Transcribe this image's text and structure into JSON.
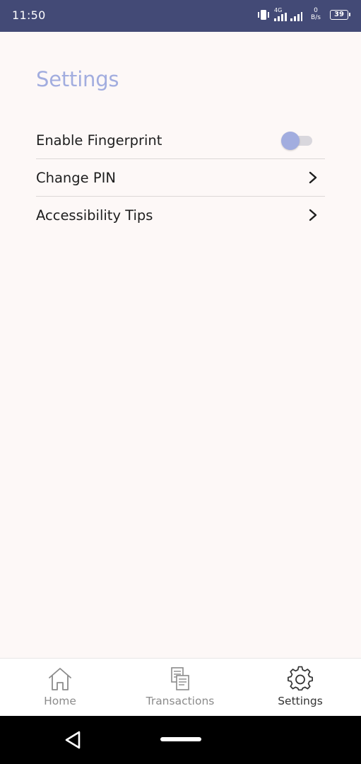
{
  "status_bar": {
    "time": "11:50",
    "network_type": "4G",
    "speed_value": "0",
    "speed_unit": "B/s",
    "battery": "39"
  },
  "page": {
    "title": "Settings"
  },
  "settings": {
    "items": [
      {
        "label": "Enable Fingerprint",
        "control": "toggle",
        "toggle_on": false
      },
      {
        "label": "Change PIN",
        "control": "chevron"
      },
      {
        "label": "Accessibility Tips",
        "control": "chevron"
      }
    ]
  },
  "bottom_nav": {
    "items": [
      {
        "label": "Home",
        "icon": "home-icon",
        "active": false
      },
      {
        "label": "Transactions",
        "icon": "transactions-icon",
        "active": false
      },
      {
        "label": "Settings",
        "icon": "gear-icon",
        "active": true
      }
    ]
  },
  "colors": {
    "status_bar_bg": "#434a76",
    "accent": "#a2addf",
    "page_bg": "#fdf8f7",
    "nav_inactive": "#8b8b8b",
    "nav_active": "#333333"
  }
}
